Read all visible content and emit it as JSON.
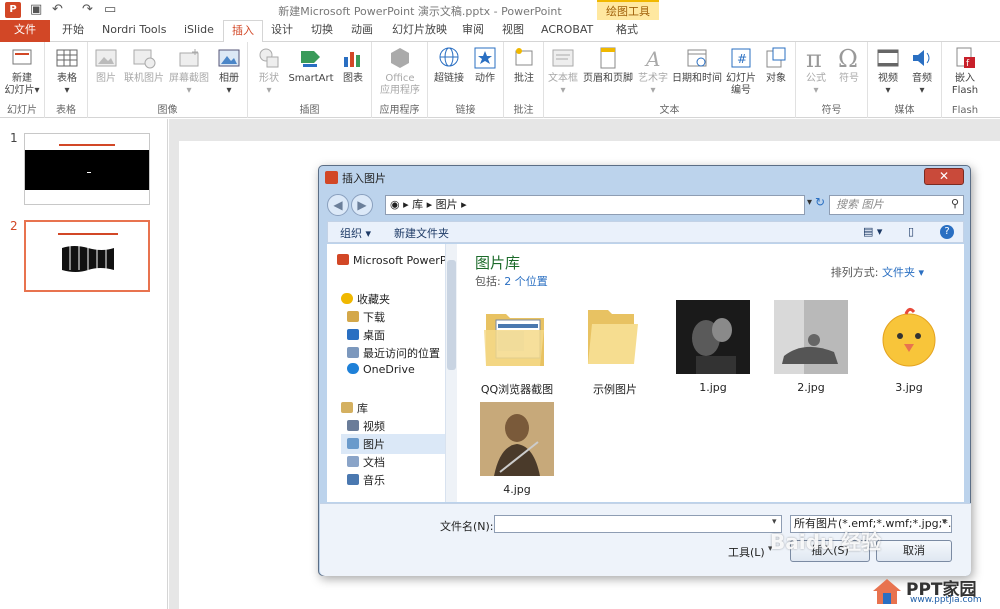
{
  "window": {
    "title": "新建Microsoft PowerPoint 演示文稿.pptx - PowerPoint",
    "context_tab_group": "绘图工具",
    "app_badge": "P"
  },
  "tabs": [
    "文件",
    "开始",
    "Nordri Tools",
    "iSlide",
    "插入",
    "设计",
    "切换",
    "动画",
    "幻灯片放映",
    "审阅",
    "视图",
    "ACROBAT",
    "格式"
  ],
  "active_tab": "插入",
  "ribbon": {
    "groups": [
      {
        "label": "幻灯片",
        "buttons": [
          {
            "label": "新建\n幻灯片",
            "arrow": "▾"
          }
        ]
      },
      {
        "label": "表格",
        "buttons": [
          {
            "label": "表格",
            "arrow": "▾"
          }
        ]
      },
      {
        "label": "图像",
        "buttons": [
          {
            "label": "图片"
          },
          {
            "label": "联机图片"
          },
          {
            "label": "屏幕截图",
            "arrow": "▾"
          },
          {
            "label": "相册",
            "arrow": "▾"
          }
        ]
      },
      {
        "label": "插图",
        "buttons": [
          {
            "label": "形状",
            "arrow": "▾"
          },
          {
            "label": "SmartArt"
          },
          {
            "label": "图表"
          }
        ]
      },
      {
        "label": "应用程序",
        "buttons": [
          {
            "label": "Office\n应用程序"
          }
        ]
      },
      {
        "label": "链接",
        "buttons": [
          {
            "label": "超链接"
          },
          {
            "label": "动作"
          }
        ]
      },
      {
        "label": "批注",
        "buttons": [
          {
            "label": "批注"
          }
        ]
      },
      {
        "label": "文本",
        "buttons": [
          {
            "label": "文本框",
            "arrow": "▾"
          },
          {
            "label": "页眉和页脚"
          },
          {
            "label": "艺术字",
            "arrow": "▾"
          },
          {
            "label": "日期和时间"
          },
          {
            "label": "幻灯片\n编号"
          },
          {
            "label": "对象"
          }
        ]
      },
      {
        "label": "符号",
        "buttons": [
          {
            "label": "公式",
            "arrow": "▾"
          },
          {
            "label": "符号"
          }
        ]
      },
      {
        "label": "媒体",
        "buttons": [
          {
            "label": "视频",
            "arrow": "▾"
          },
          {
            "label": "音频",
            "arrow": "▾"
          }
        ]
      },
      {
        "label": "Flash",
        "buttons": [
          {
            "label": "嵌入\nFlash"
          }
        ]
      }
    ]
  },
  "slides": [
    {
      "number": "1"
    },
    {
      "number": "2"
    }
  ],
  "dialog": {
    "title": "插入图片",
    "close": "✕",
    "breadcrumb": [
      "库",
      "图片"
    ],
    "search_placeholder": "搜索 图片",
    "toolbar": {
      "organize": "组织 ▾",
      "new_folder": "新建文件夹"
    },
    "nav": {
      "app": "Microsoft PowerPoint",
      "favorites": "收藏夹",
      "favorites_items": [
        "下载",
        "桌面",
        "最近访问的位置",
        "OneDrive"
      ],
      "libraries": "库",
      "library_items": [
        "视频",
        "图片",
        "文档",
        "音乐"
      ]
    },
    "library": {
      "title": "图片库",
      "includes_prefix": "包括:",
      "includes_link": "2 个位置",
      "arrange_by": "排列方式:",
      "arrange_value": "文件夹 ▾"
    },
    "files": [
      {
        "name": "QQ浏览器截图",
        "kind": "folder-docs"
      },
      {
        "name": "示例图片",
        "kind": "folder"
      },
      {
        "name": "1.jpg",
        "kind": "photo-dark"
      },
      {
        "name": "2.jpg",
        "kind": "photo-gray"
      },
      {
        "name": "3.jpg",
        "kind": "photo-chick"
      },
      {
        "name": "4.jpg",
        "kind": "photo-warrior"
      }
    ],
    "filename_label": "文件名(N):",
    "filename_value": "",
    "filetype_value": "所有图片(*.emf;*.wmf;*.jpg;*.j",
    "tools_label": "工具(L)",
    "insert_label": "插入(S)",
    "cancel_label": "取消"
  },
  "watermark": {
    "text": "PPT家园",
    "url": "www.pptjia.com",
    "overlay": "Baidu 经验"
  }
}
